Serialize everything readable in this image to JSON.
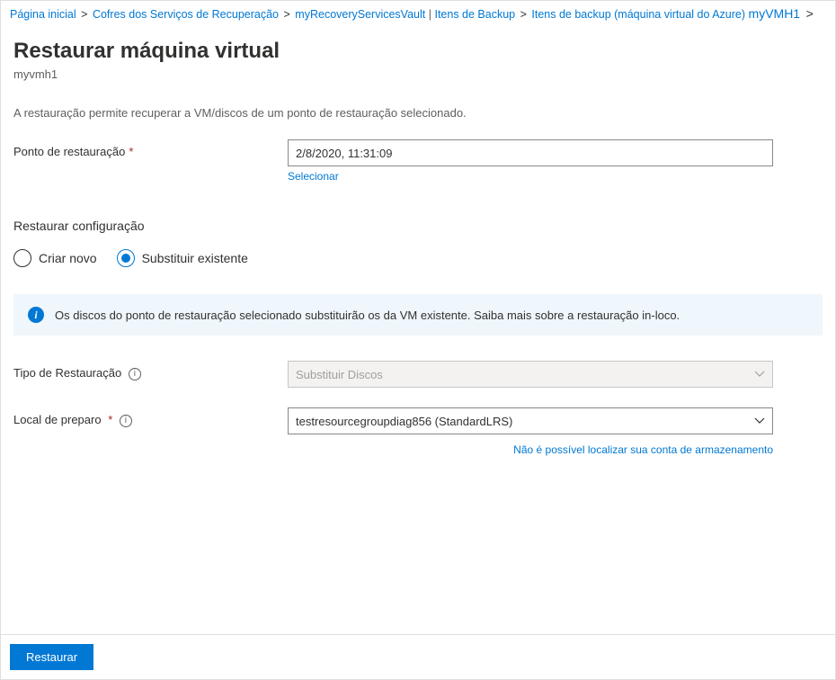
{
  "breadcrumb": {
    "home": "Página inicial",
    "vaults": "Cofres dos Serviços de Recuperação",
    "vault_name": "myRecoveryServicesVault",
    "backup_items": "Itens de Backup",
    "backup_items_type": "Itens de backup (máquina virtual do Azure)",
    "vm_name": "myVMH1"
  },
  "page": {
    "title": "Restaurar máquina virtual",
    "subtitle": "myvmh1",
    "description": "A restauração permite recuperar a VM/discos de um ponto de restauração selecionado."
  },
  "restore_point": {
    "label": "Ponto de restauração",
    "value": "2/8/2020, 11:31:09",
    "select_link": "Selecionar"
  },
  "restore_config": {
    "heading": "Restaurar configuração",
    "option_create_new": "Criar novo",
    "option_replace_existing": "Substituir existente",
    "info_message": "Os discos do ponto de restauração selecionado substituirão os da VM existente. Saiba mais sobre a restauração in-loco."
  },
  "restore_type": {
    "label": "Tipo de Restauração",
    "value": "Substituir Discos"
  },
  "staging": {
    "label": "Local de preparo",
    "value": "testresourcegroupdiag856 (StandardLRS)",
    "helper_link": "Não é possível localizar sua conta de armazenamento"
  },
  "footer": {
    "restore_button": "Restaurar"
  }
}
